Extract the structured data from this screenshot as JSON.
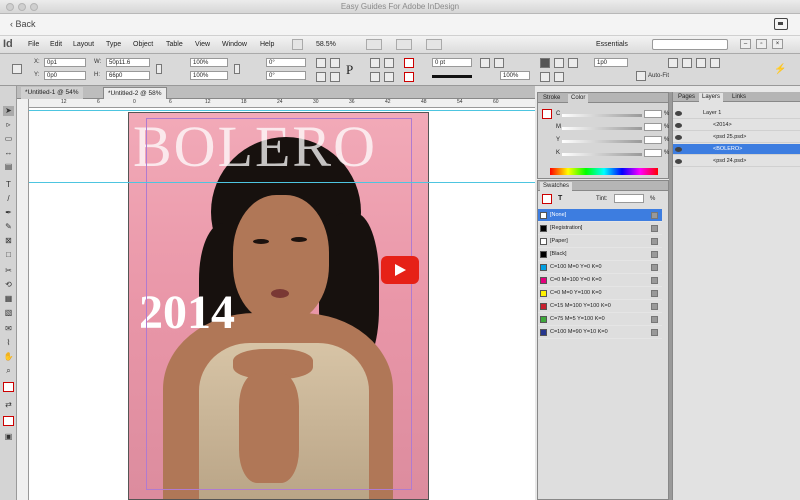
{
  "window": {
    "title": "Easy Guides For Adobe InDesign"
  },
  "nav": {
    "back_label": "Back"
  },
  "app": {
    "logo": "Id",
    "menus": [
      "File",
      "Edit",
      "Layout",
      "Type",
      "Object",
      "Table",
      "View",
      "Window",
      "Help"
    ],
    "zoom": "58.5%",
    "workspace": "Essentials"
  },
  "control": {
    "x_label": "X:",
    "x_value": "0p1",
    "y_label": "Y:",
    "y_value": "0p0",
    "w_label": "W:",
    "w_value": "50p11.6",
    "h_label": "H:",
    "h_value": "66p0",
    "scale_x": "100%",
    "scale_y": "100%",
    "rotate": "0°",
    "shear": "0°",
    "stroke_weight": "0 pt",
    "opacity": "100%",
    "fit_value": "1p0",
    "auto_fit": "Auto-Fit"
  },
  "tabs": [
    {
      "label": "*Untitled-1 @ 54%"
    },
    {
      "label": "*Untitled-2 @ 58%"
    }
  ],
  "ruler": {
    "marks": [
      "12",
      "6",
      "0",
      "6",
      "12",
      "18",
      "24",
      "30",
      "36",
      "42",
      "48",
      "54",
      "60"
    ]
  },
  "document": {
    "cover_title": "BOLERO",
    "cover_year": "2014"
  },
  "color_panel": {
    "tabs": [
      "Stroke",
      "Color"
    ],
    "channels": [
      "C",
      "M",
      "Y",
      "K"
    ],
    "pct": "%"
  },
  "swatches_panel": {
    "title": "Swatches",
    "tint_label": "Tint:",
    "tint_pct": "%",
    "items": [
      {
        "name": "[None]",
        "color": "#ffffff"
      },
      {
        "name": "[Registration]",
        "color": "#000000"
      },
      {
        "name": "[Paper]",
        "color": "#ffffff"
      },
      {
        "name": "[Black]",
        "color": "#000000"
      },
      {
        "name": "C=100 M=0 Y=0 K=0",
        "color": "#00a0e3"
      },
      {
        "name": "C=0 M=100 Y=0 K=0",
        "color": "#e3007c"
      },
      {
        "name": "C=0 M=0 Y=100 K=0",
        "color": "#fff200"
      },
      {
        "name": "C=15 M=100 Y=100 K=0",
        "color": "#c8202f"
      },
      {
        "name": "C=75 M=5 Y=100 K=0",
        "color": "#3ea83a"
      },
      {
        "name": "C=100 M=90 Y=10 K=0",
        "color": "#26378e"
      }
    ]
  },
  "layers_panel": {
    "tabs": [
      "Pages",
      "Layers",
      "Links"
    ],
    "items": [
      {
        "name": "Layer 1"
      },
      {
        "name": "<2014>"
      },
      {
        "name": "<psd 25.psd>"
      },
      {
        "name": "<BOLERO>"
      },
      {
        "name": "<psd 24.psd>"
      }
    ]
  },
  "colors": {
    "accent": "#3d7de0",
    "play": "#e62117"
  }
}
